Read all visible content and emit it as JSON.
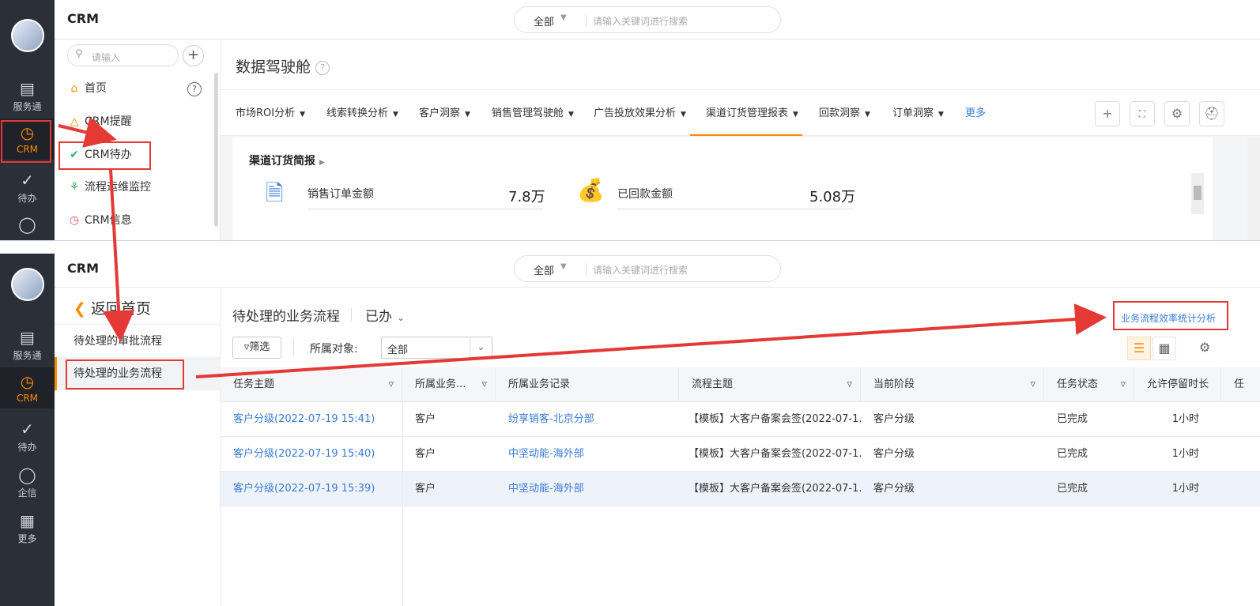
{
  "app": {
    "title": "CRM"
  },
  "search": {
    "scope": "全部",
    "placeholder": "请输入关键词进行搜索"
  },
  "rail": {
    "service": "服务通",
    "crm": "CRM",
    "todo": "待办",
    "chat": "企信",
    "more": "更多"
  },
  "sidebar": {
    "search_placeholder": "请输入",
    "items": [
      {
        "label": "首页"
      },
      {
        "label": "CRM提醒"
      },
      {
        "label": "CRM待办"
      },
      {
        "label": "流程运维监控"
      },
      {
        "label": "CRM信息"
      }
    ]
  },
  "dashboard": {
    "title": "数据驾驶舱",
    "tabs": [
      "市场ROI分析",
      "线索转换分析",
      "客户洞察",
      "销售管理驾驶舱",
      "广告投放效果分析",
      "渠道订货管理报表",
      "回款洞察",
      "订单洞察"
    ],
    "more_label": "更多",
    "card_title": "渠道订货简报",
    "metrics": [
      {
        "label": "销售订单金额",
        "value": "7.8万"
      },
      {
        "label": "已回款金额",
        "value": "5.08万"
      }
    ]
  },
  "todo_page": {
    "back_label": "返回首页",
    "nav": [
      "待处理的审批流程",
      "待处理的业务流程"
    ],
    "title": "待处理的业务流程",
    "status": "已办",
    "stats_link": "业务流程效率统计分析",
    "filter_label": "筛选",
    "object_label": "所属对象:",
    "object_value": "全部",
    "columns": [
      "任务主题",
      "所属业务...",
      "所属业务记录",
      "流程主题",
      "当前阶段",
      "任务状态",
      "允许停留时长",
      "任"
    ],
    "rows": [
      {
        "task": "客户分级(2022-07-19 15:41)",
        "biz": "客户",
        "record": "纷享销客-北京分部",
        "flow": "【模板】大客户备案会签(2022-07-1...",
        "stage": "客户分级",
        "status": "已完成",
        "duration": "1小时"
      },
      {
        "task": "客户分级(2022-07-19 15:40)",
        "biz": "客户",
        "record": "中坚动能-海外部",
        "flow": "【模板】大客户备案会签(2022-07-1...",
        "stage": "客户分级",
        "status": "已完成",
        "duration": "1小时"
      },
      {
        "task": "客户分级(2022-07-19 15:39)",
        "biz": "客户",
        "record": "中坚动能-海外部",
        "flow": "【模板】大客户备案会签(2022-07-1...",
        "stage": "客户分级",
        "status": "已完成",
        "duration": "1小时"
      }
    ]
  },
  "colors": {
    "accent": "#ff8a00",
    "link": "#3a7bd5",
    "annotation": "#e53935",
    "rail": "#2b2f38"
  }
}
